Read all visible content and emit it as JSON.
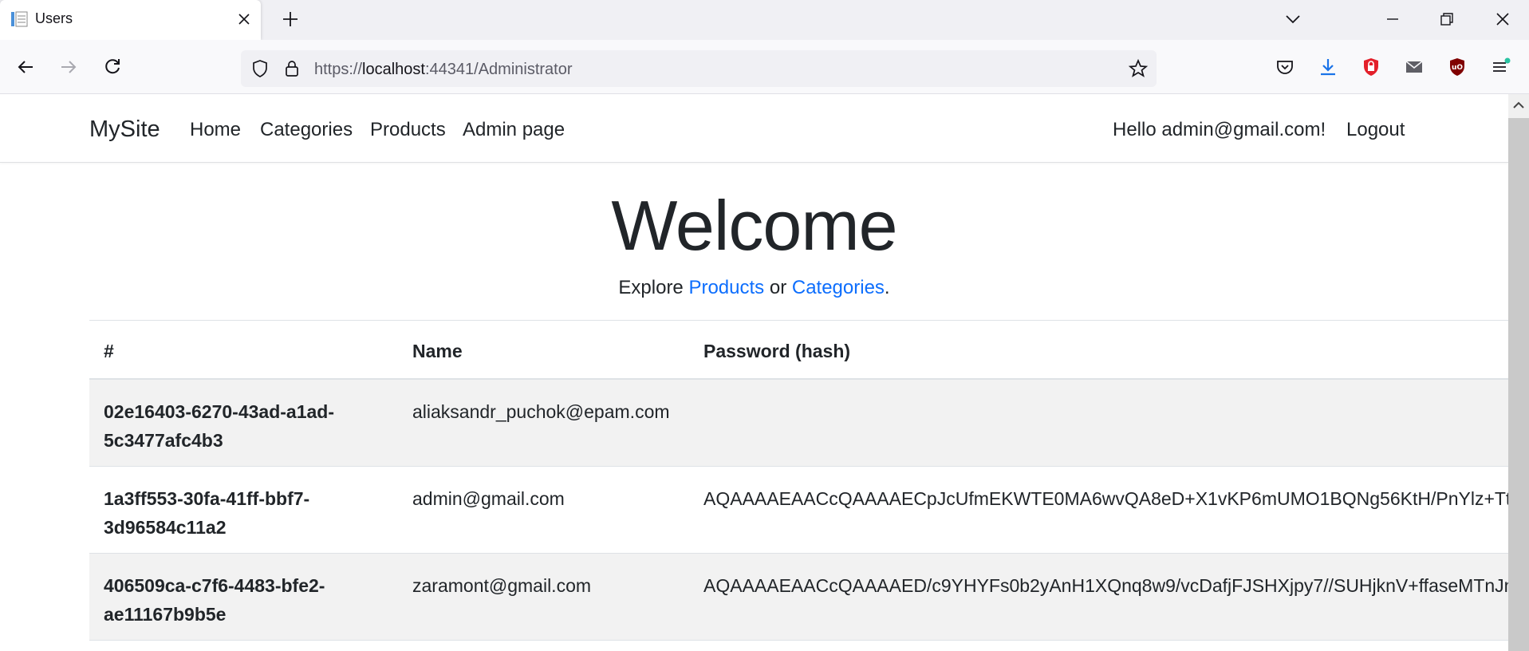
{
  "browser": {
    "tab_title": "Users",
    "url_scheme": "https://",
    "url_host": "localhost",
    "url_rest": ":44341/Administrator"
  },
  "site": {
    "brand": "MySite",
    "nav": [
      "Home",
      "Categories",
      "Products",
      "Admin page"
    ],
    "greeting": "Hello admin@gmail.com!",
    "logout": "Logout"
  },
  "hero": {
    "title": "Welcome",
    "explore_prefix": "Explore ",
    "products_link": "Products",
    "or_text": " or ",
    "categories_link": "Categories",
    "suffix": "."
  },
  "table": {
    "headers": [
      "#",
      "Name",
      "Password (hash)"
    ],
    "rows": [
      {
        "id": "02e16403-6270-43ad-a1ad-5c3477afc4b3",
        "name": "aliaksandr_puchok@epam.com",
        "hash": ""
      },
      {
        "id": "1a3ff553-30fa-41ff-bbf7-3d96584c11a2",
        "name": "admin@gmail.com",
        "hash": "AQAAAAEAACcQAAAAECpJcUfmEKWTE0MA6wvQA8eD+X1vKP6mUMO1BQNg56KtH/PnYlz+Tt"
      },
      {
        "id": "406509ca-c7f6-4483-bfe2-ae11167b9b5e",
        "name": "zaramont@gmail.com",
        "hash": "AQAAAAEAACcQAAAAED/c9YHYFs0b2yAnH1XQnq8w9/vcDafjFJSHXjpy7//SUHjknV+ffaseMTnJm"
      }
    ]
  },
  "colors": {
    "link": "#0d6efd",
    "stripe": "#f2f2f2",
    "chrome": "#f0f0f4"
  }
}
